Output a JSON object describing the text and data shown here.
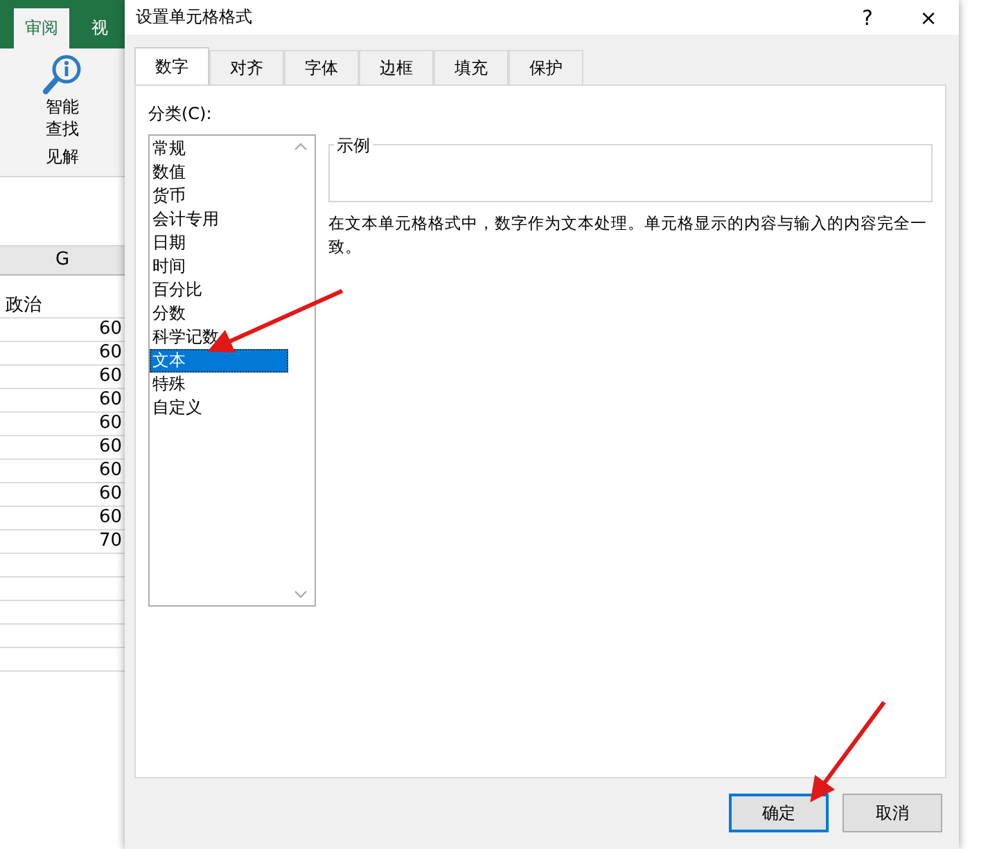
{
  "excel": {
    "ribbon_tabs": [
      {
        "label": "审阅",
        "selected": true
      },
      {
        "label": "视",
        "selected": false
      }
    ],
    "ribbon_button": {
      "label": "智能查找"
    },
    "ribbon_group": "见解",
    "column_header": "G",
    "header_cell": "政治",
    "cells": [
      "60",
      "60",
      "60",
      "60",
      "60",
      "60",
      "60",
      "60",
      "60",
      "70"
    ]
  },
  "dialog": {
    "title": "设置单元格格式",
    "help": "?",
    "close": "×",
    "tabs": [
      {
        "label": "数字",
        "selected": true
      },
      {
        "label": "对齐",
        "selected": false
      },
      {
        "label": "字体",
        "selected": false
      },
      {
        "label": "边框",
        "selected": false
      },
      {
        "label": "填充",
        "selected": false
      },
      {
        "label": "保护",
        "selected": false
      }
    ],
    "category_label": "分类(C):",
    "categories": [
      {
        "label": "常规",
        "selected": false
      },
      {
        "label": "数值",
        "selected": false
      },
      {
        "label": "货币",
        "selected": false
      },
      {
        "label": "会计专用",
        "selected": false
      },
      {
        "label": "日期",
        "selected": false
      },
      {
        "label": "时间",
        "selected": false
      },
      {
        "label": "百分比",
        "selected": false
      },
      {
        "label": "分数",
        "selected": false
      },
      {
        "label": "科学记数",
        "selected": false
      },
      {
        "label": "文本",
        "selected": true
      },
      {
        "label": "特殊",
        "selected": false
      },
      {
        "label": "自定义",
        "selected": false
      }
    ],
    "sample_label": "示例",
    "description": "在文本单元格格式中，数字作为文本处理。单元格显示的内容与输入的内容完全一致。",
    "buttons": [
      {
        "label": "确定",
        "kind": "primary"
      },
      {
        "label": "取消",
        "kind": "normal"
      }
    ]
  }
}
